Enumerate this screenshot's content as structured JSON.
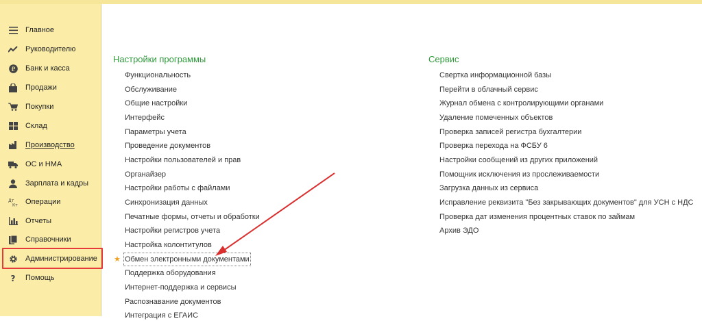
{
  "sidebar": {
    "items": [
      {
        "label": "Главное",
        "icon": "menu-lines-icon"
      },
      {
        "label": "Руководителю",
        "icon": "trend-icon"
      },
      {
        "label": "Банк и касса",
        "icon": "ruble-icon"
      },
      {
        "label": "Продажи",
        "icon": "bag-icon"
      },
      {
        "label": "Покупки",
        "icon": "cart-icon"
      },
      {
        "label": "Склад",
        "icon": "warehouse-icon"
      },
      {
        "label": "Производство",
        "icon": "factory-icon"
      },
      {
        "label": "ОС и НМА",
        "icon": "truck-icon"
      },
      {
        "label": "Зарплата и кадры",
        "icon": "person-icon"
      },
      {
        "label": "Операции",
        "icon": "dt-kt-icon"
      },
      {
        "label": "Отчеты",
        "icon": "bar-chart-icon"
      },
      {
        "label": "Справочники",
        "icon": "books-icon"
      },
      {
        "label": "Администрирование",
        "icon": "gear-icon"
      },
      {
        "label": "Помощь",
        "icon": "question-icon"
      }
    ]
  },
  "settings": {
    "title": "Настройки программы",
    "links": [
      "Функциональность",
      "Обслуживание",
      "Общие настройки",
      "Интерфейс",
      "Параметры учета",
      "Проведение документов",
      "Настройки пользователей и прав",
      "Органайзер",
      "Настройки работы с файлами",
      "Синхронизация данных",
      "Печатные формы, отчеты и обработки",
      "Настройки регистров учета",
      "Настройка колонтитулов",
      "Обмен электронными документами",
      "Поддержка оборудования",
      "Интернет-поддержка и сервисы",
      "Распознавание документов",
      "Интеграция с ЕГАИС"
    ]
  },
  "service": {
    "title": "Сервис",
    "links": [
      "Свертка информационной базы",
      "Перейти в облачный сервис",
      "Журнал обмена с контролирующими органами",
      "Удаление помеченных объектов",
      "Проверка записей регистра бухгалтерии",
      "Проверка перехода на ФСБУ 6",
      "Настройки сообщений из других приложений",
      "Помощник исключения из прослеживаемости",
      "Загрузка данных из сервиса",
      "Исправление реквизита \"Без закрывающих документов\" для УСН с НДС",
      "Проверка дат изменения процентных ставок по займам",
      "Архив ЭДО"
    ]
  },
  "colors": {
    "sidebar_bg": "#fbeda8",
    "section_title": "#2f9a3b",
    "highlight": "#e53b3b",
    "arrow": "#d9302f",
    "favorite_star": "#f0a020"
  }
}
